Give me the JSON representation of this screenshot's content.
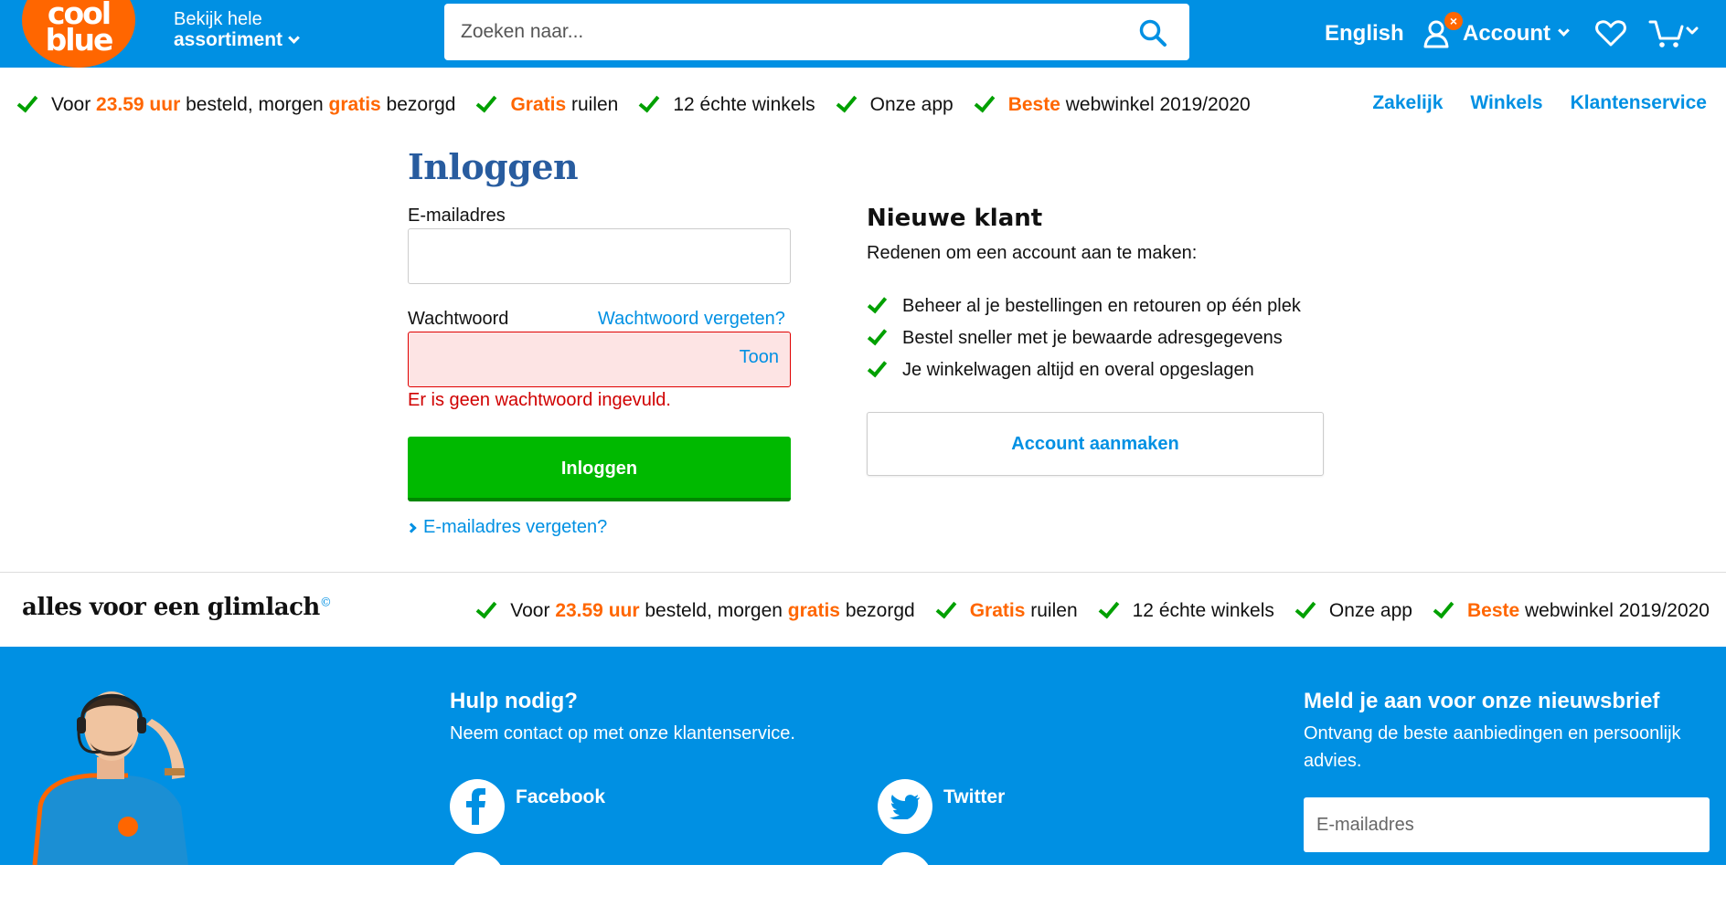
{
  "header": {
    "logo_line1": "cool",
    "logo_line2": "blue",
    "assortment_small": "Bekijk hele",
    "assortment_big": "assortiment",
    "search_placeholder": "Zoeken naar...",
    "language": "English",
    "account_label": "Account",
    "account_badge": "×"
  },
  "usp_top": [
    {
      "pre": "Voor ",
      "hl1": "23.59 uur",
      "mid": " besteld, morgen ",
      "hl2": "gratis",
      "post": " bezorgd"
    },
    {
      "pre": "",
      "hl1": "Gratis",
      "mid": " ruilen",
      "hl2": "",
      "post": ""
    },
    {
      "pre": "12 échte winkels",
      "hl1": "",
      "mid": "",
      "hl2": "",
      "post": ""
    },
    {
      "pre": "Onze app",
      "hl1": "",
      "mid": "",
      "hl2": "",
      "post": ""
    },
    {
      "pre": "",
      "hl1": "Beste",
      "mid": " webwinkel 2019/2020",
      "hl2": "",
      "post": ""
    }
  ],
  "top_links": [
    "Zakelijk",
    "Winkels",
    "Klantenservice"
  ],
  "login": {
    "title": "Inloggen",
    "email_label": "E-mailadres",
    "email_value": "",
    "password_label": "Wachtwoord",
    "password_forgot": "Wachtwoord vergeten?",
    "password_value": "",
    "show_label": "Toon",
    "error": "Er is geen wachtwoord ingevuld.",
    "submit": "Inloggen",
    "forgot_email": "E-mailadres vergeten?"
  },
  "new_customer": {
    "title": "Nieuwe klant",
    "subtitle": "Redenen om een account aan te maken:",
    "reasons": [
      "Beheer al je bestellingen en retouren op één plek",
      "Bestel sneller met je bewaarde adresgegevens",
      "Je winkelwagen altijd en overal opgeslagen"
    ],
    "create_button": "Account aanmaken"
  },
  "slogan": "alles voor een glimlach",
  "slogan_mark": "©",
  "footer": {
    "help_title": "Hulp nodig?",
    "help_text": "Neem contact op met onze klantenservice.",
    "social": [
      "Facebook",
      "Twitter"
    ],
    "newsletter_title": "Meld je aan voor onze nieuwsbrief",
    "newsletter_text": "Ontvang de beste aanbiedingen en persoonlijk advies.",
    "newsletter_placeholder": "E-mailadres"
  },
  "colors": {
    "brand_blue": "#0090e3",
    "brand_orange": "#ff6600",
    "success_green": "#00b900",
    "error_red": "#d00000"
  }
}
